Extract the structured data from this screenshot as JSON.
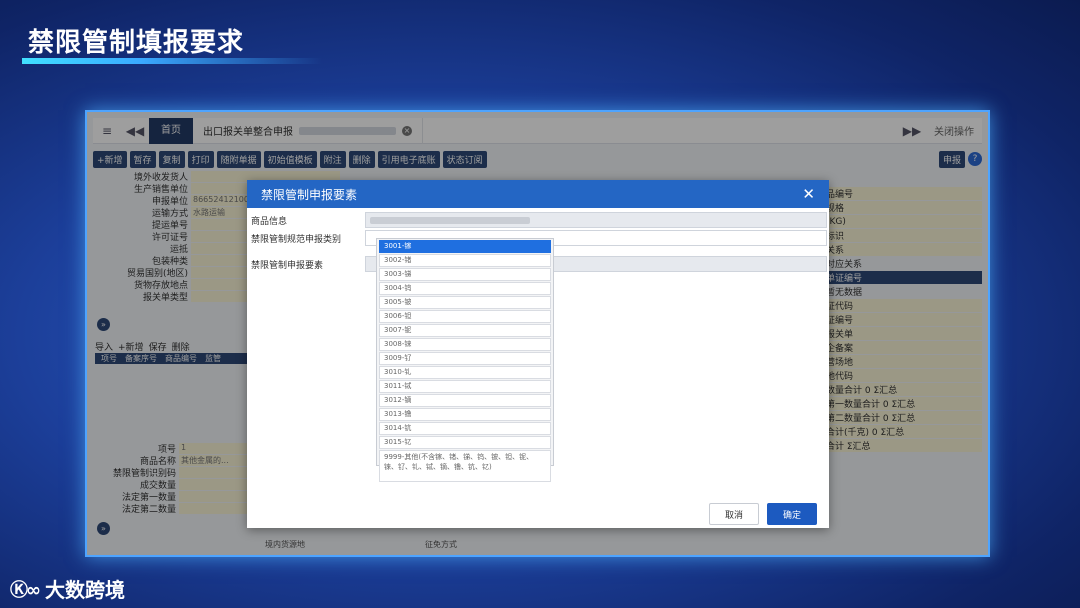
{
  "slide": {
    "title": "禁限管制填报要求",
    "brand": "大数跨境",
    "brand_logo": "Ⓚ∞"
  },
  "tabbar": {
    "home_tab": "首页",
    "main_tab": "出口报关单整合申报",
    "close_right": "关闭操作"
  },
  "toolbar": {
    "buttons": [
      "+新增",
      "暂存",
      "复制",
      "打印",
      "随附单据",
      "初始值模板",
      "附注",
      "删除",
      "引用电子底账",
      "状态订阅"
    ],
    "declare": "申报",
    "help": "?"
  },
  "left_form": [
    {
      "label": "境外收发货人",
      "value": ""
    },
    {
      "label": "生产销售单位",
      "value": ""
    },
    {
      "label": "申报单位",
      "value": "8665241210000"
    },
    {
      "label": "运输方式",
      "value": "水路运输"
    },
    {
      "label": "提运单号",
      "value": ""
    },
    {
      "label": "许可证号",
      "value": ""
    },
    {
      "label": "运抵",
      "value": ""
    },
    {
      "label": "包装种类",
      "value": ""
    },
    {
      "label": "贸易国别(地区)",
      "value": ""
    },
    {
      "label": "货物存放地点",
      "value": ""
    },
    {
      "label": "报关单类型",
      "value": ""
    }
  ],
  "right_form": [
    "品编号",
    "规格",
    "(KG)",
    "标识",
    "关系",
    "对应关系",
    "单证编号",
    "暂无数据",
    "证代码",
    "证编号",
    "报关单",
    "企备案",
    "营场地",
    "地代码",
    "数量合计 0 Σ汇总",
    "第一数量合计 0 Σ汇总",
    "第二数量合计 0 Σ汇总",
    "合计(千克) 0 Σ汇总",
    "合计 Σ汇总"
  ],
  "left_table": {
    "actions": [
      "导入",
      "+新增",
      "保存",
      "删除"
    ],
    "headers": [
      "项号",
      "备案序号",
      "商品编号",
      "监管"
    ]
  },
  "left_lower": [
    {
      "label": "项号",
      "value": "1"
    },
    {
      "label": "商品名称",
      "value": "其他金属的..."
    },
    {
      "label": "禁限管制识别码",
      "value": ""
    },
    {
      "label": "成交数量",
      "value": ""
    },
    {
      "label": "法定第一数量",
      "value": ""
    },
    {
      "label": "法定第二数量",
      "value": ""
    }
  ],
  "dialog": {
    "title": "禁限管制申报要素",
    "rows": {
      "goods_info": "商品信息",
      "category": "禁限管制规范申报类别",
      "elements": "禁限管制申报要素"
    },
    "dropdown_items": [
      "3001-镓",
      "3002-锗",
      "3003-锑",
      "3004-钨",
      "3005-铍",
      "3006-钽",
      "3007-铌",
      "3008-铼",
      "3009-钌",
      "3010-钆",
      "3011-铽",
      "3012-镝",
      "3013-镥",
      "3014-钪",
      "3015-钇",
      "9999-其他(不含镓、锗、锑、钨、铍、钽、铌、铼、钌、钆、铽、镝、镥、钪、钇)"
    ],
    "cancel": "取消",
    "ok": "确定"
  },
  "bottom_strip": [
    "境内货源地",
    "征免方式"
  ]
}
